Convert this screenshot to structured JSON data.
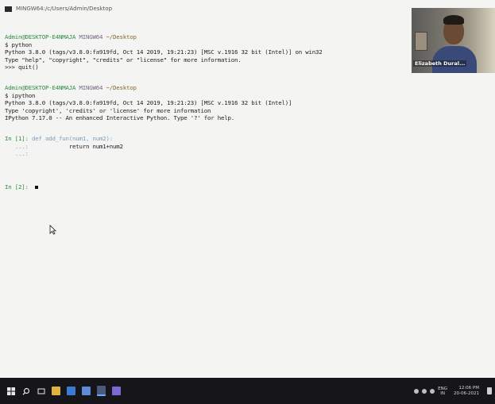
{
  "window": {
    "title": "MINGW64:/c/Users/Admin/Desktop"
  },
  "terminal": {
    "session1": {
      "prompt_user": "Admin@DESKTOP-E4NMAJA",
      "prompt_shell": "MINGW64",
      "prompt_path": "~/Desktop",
      "command": "$ python",
      "output": [
        "Python 3.8.0 (tags/v3.8.0:fa919fd, Oct 14 2019, 19:21:23) [MSC v.1916 32 bit (Intel)] on win32",
        "Type \"help\", \"copyright\", \"credits\" or \"license\" for more information."
      ],
      "repl_command": ">>> quit()"
    },
    "session2": {
      "prompt_user": "Admin@DESKTOP-E4NMAJA",
      "prompt_shell": "MINGW64",
      "prompt_path": "~/Desktop",
      "command": "$ ipython",
      "output": [
        "Python 3.8.0 (tags/v3.8.0:fa919fd, Oct 14 2019, 19:21:23) [MSC v.1916 32 bit (Intel)]",
        "Type 'copyright', 'credits' or 'license' for more information",
        "IPython 7.17.0 -- An enhanced Interactive Python. Type '?' for help."
      ]
    },
    "cell1": {
      "in_prompt": "In [1]:",
      "code_line1": "def add_fun(num1, num2):",
      "code_line2": "    return num1+num2",
      "continuation": "   ...:"
    },
    "cell2": {
      "in_prompt": "In [2]:"
    }
  },
  "webcam": {
    "name": "Elizabeth Dural..."
  },
  "taskbar": {
    "icons": [
      "windows-start-icon",
      "search-icon",
      "file-explorer-icon",
      "mail-icon",
      "store-icon",
      "terminal-icon",
      "chat-icon"
    ],
    "language": "ENG",
    "language_region": "IN",
    "time": "12:06 PM",
    "date": "20-06-2021"
  },
  "colors": {
    "background": "#f4f4f2",
    "prompt_user": "#2e8b44",
    "prompt_path": "#8a6a2a",
    "taskbar": "#16161a"
  }
}
